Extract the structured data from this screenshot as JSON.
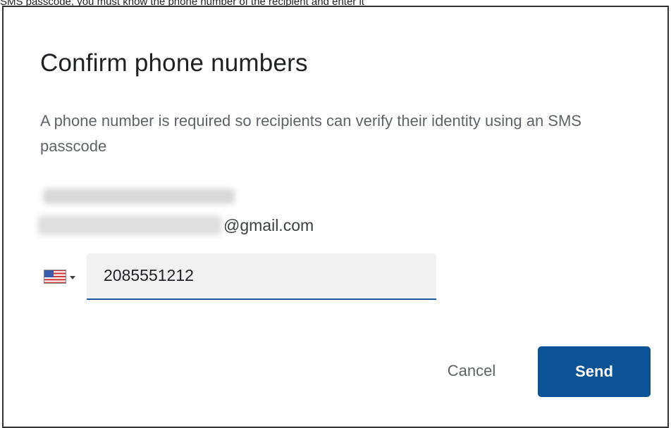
{
  "caption": "SMS passcode, you must know the phone number of the recipient and enter it",
  "dialog": {
    "title": "Confirm phone numbers",
    "description": "A phone number is required so recipients can verify their identity using an SMS passcode",
    "recipient": {
      "email_domain": "@gmail.com"
    },
    "phone": {
      "country_flag_icon": "us-flag-icon",
      "value": "2085551212"
    },
    "actions": {
      "cancel_label": "Cancel",
      "send_label": "Send"
    }
  },
  "colors": {
    "primary": "#0b5394",
    "focus_underline": "#1a5aa0",
    "text_secondary": "#5f6368"
  }
}
